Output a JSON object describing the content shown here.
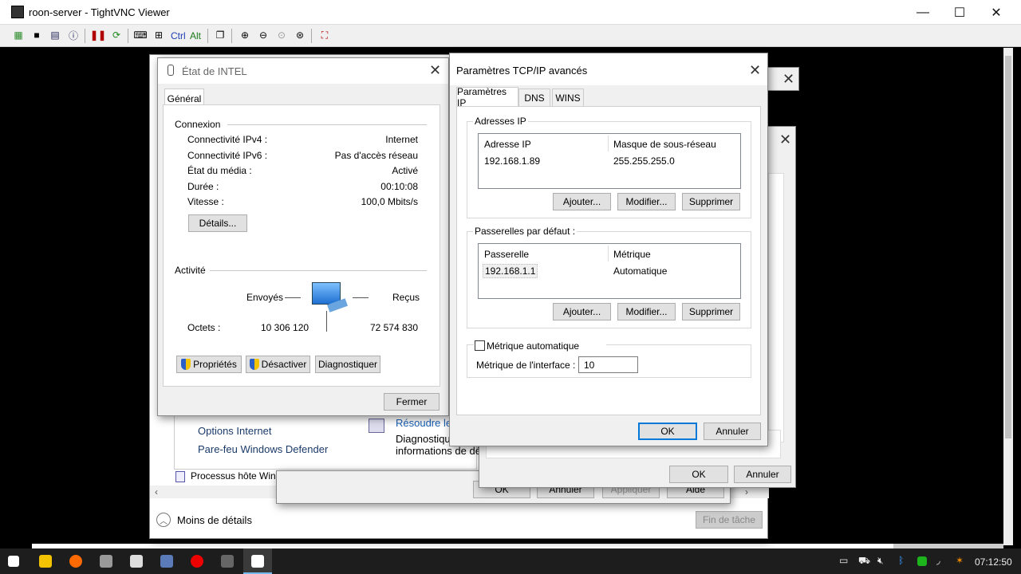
{
  "window": {
    "title": "roon-server - TightVNC Viewer",
    "minimize": "—",
    "maximize": "☐",
    "close": "✕"
  },
  "toolbar": {
    "icons": [
      "new-connection-icon",
      "save-icon",
      "options-icon",
      "info-icon",
      "pause-icon",
      "refresh-icon",
      "ctrl-alt-del-icon",
      "ctrl-esc-icon"
    ],
    "ctrl": "Ctrl",
    "alt": "Alt"
  },
  "back": {
    "items": [
      "Options Internet",
      "Pare-feu Windows Defender"
    ],
    "troubleshoot": "Résoudre les",
    "diag_line1": "Diagnostique",
    "diag_line2": "informations de dép",
    "process": "Processus hôte Wind",
    "less_details": "Moins de détails",
    "end_task": "Fin de tâche",
    "ok": "OK",
    "cancel": "Annuler",
    "apply": "Appliquer",
    "help": "Aide"
  },
  "mid": {
    "ok": "OK",
    "cancel": "Annuler"
  },
  "status": {
    "title": "État de INTEL",
    "tab": "Général",
    "conn_section": "Connexion",
    "rows": [
      {
        "label": "Connectivité IPv4 :",
        "value": "Internet"
      },
      {
        "label": "Connectivité IPv6 :",
        "value": "Pas d'accès réseau"
      },
      {
        "label": "État du média :",
        "value": "Activé"
      },
      {
        "label": "Durée :",
        "value": "00:10:08"
      },
      {
        "label": "Vitesse :",
        "value": "100,0 Mbits/s"
      }
    ],
    "details": "Détails...",
    "activity": "Activité",
    "sent": "Envoyés",
    "received": "Reçus",
    "bytes": "Octets :",
    "bytes_sent": "10 306 120",
    "bytes_recv": "72 574 830",
    "properties": "Propriétés",
    "disable": "Désactiver",
    "diagnose": "Diagnostiquer",
    "close": "Fermer"
  },
  "tcp": {
    "title": "Paramètres TCP/IP avancés",
    "tabs": [
      "Paramètres IP",
      "DNS",
      "WINS"
    ],
    "ip_section": "Adresses IP",
    "ip_col1": "Adresse IP",
    "ip_col2": "Masque de sous-réseau",
    "ip": "192.168.1.89",
    "mask": "255.255.255.0",
    "add": "Ajouter...",
    "modify": "Modifier...",
    "delete": "Supprimer",
    "gw_section": "Passerelles par défaut :",
    "gw_col1": "Passerelle",
    "gw_col2": "Métrique",
    "gw": "192.168.1.1",
    "gw_metric": "Automatique",
    "auto_metric": "Métrique automatique",
    "iface_metric_label": "Métrique de l'interface :",
    "iface_metric_value": "10",
    "ok": "OK",
    "cancel": "Annuler"
  },
  "taskbar": {
    "time": "07:12:50"
  }
}
